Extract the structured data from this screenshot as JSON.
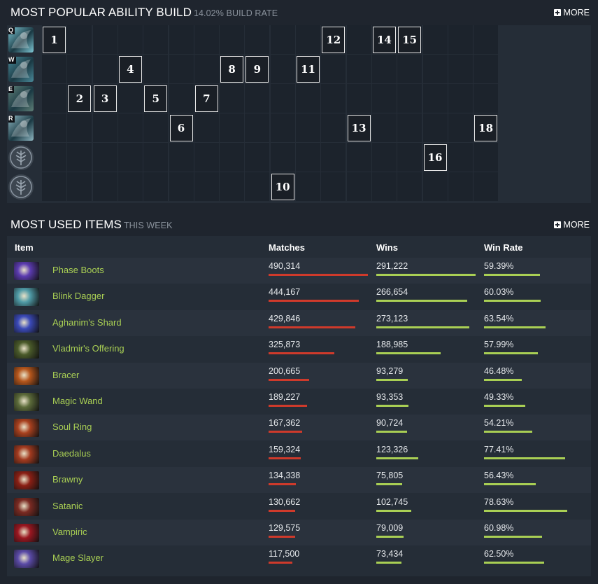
{
  "ability_build": {
    "title": "Most Popular Ability Build",
    "subtitle": "14.02% Build Rate",
    "more_label": "MORE",
    "abilities": [
      {
        "key": "Q",
        "icon": "ability-q-icon",
        "color": "#7fc9d6"
      },
      {
        "key": "W",
        "icon": "ability-w-icon",
        "color": "#4a8a9a"
      },
      {
        "key": "E",
        "icon": "ability-e-icon",
        "color": "#5f7f77"
      },
      {
        "key": "R",
        "icon": "ability-r-icon",
        "color": "#8fb7c2"
      },
      {
        "key": "",
        "icon": "talent-tree-icon",
        "color": "#3d4650"
      },
      {
        "key": "",
        "icon": "talent-tree-icon",
        "color": "#3d4650"
      }
    ],
    "levels": [
      {
        "level": "1",
        "row": 0,
        "col": 0
      },
      {
        "level": "2",
        "row": 2,
        "col": 1
      },
      {
        "level": "3",
        "row": 2,
        "col": 2
      },
      {
        "level": "4",
        "row": 1,
        "col": 3
      },
      {
        "level": "5",
        "row": 2,
        "col": 4
      },
      {
        "level": "6",
        "row": 3,
        "col": 5
      },
      {
        "level": "7",
        "row": 2,
        "col": 6
      },
      {
        "level": "8",
        "row": 1,
        "col": 7
      },
      {
        "level": "9",
        "row": 1,
        "col": 8
      },
      {
        "level": "10",
        "row": 5,
        "col": 9
      },
      {
        "level": "11",
        "row": 1,
        "col": 10
      },
      {
        "level": "12",
        "row": 0,
        "col": 11
      },
      {
        "level": "13",
        "row": 3,
        "col": 12
      },
      {
        "level": "14",
        "row": 0,
        "col": 13
      },
      {
        "level": "15",
        "row": 0,
        "col": 14
      },
      {
        "level": "16",
        "row": 4,
        "col": 15
      },
      {
        "level": "18",
        "row": 3,
        "col": 17
      }
    ]
  },
  "items": {
    "title": "Most Used Items",
    "subtitle": "This Week",
    "more_label": "MORE",
    "headers": {
      "item": "Item",
      "matches": "Matches",
      "wins": "Wins",
      "win_rate": "Win Rate"
    },
    "rows": [
      {
        "name": "Phase Boots",
        "matches": "490,314",
        "wins": "291,222",
        "win_rate": "59.39%",
        "m": 490314,
        "w": 291222,
        "wr": 59.39,
        "icon": "phase-boots-icon",
        "color": "#5b3bb0"
      },
      {
        "name": "Blink Dagger",
        "matches": "444,167",
        "wins": "266,654",
        "win_rate": "60.03%",
        "m": 444167,
        "w": 266654,
        "wr": 60.03,
        "icon": "blink-dagger-icon",
        "color": "#4f9aa6"
      },
      {
        "name": "Aghanim's Shard",
        "matches": "429,846",
        "wins": "273,123",
        "win_rate": "63.54%",
        "m": 429846,
        "w": 273123,
        "wr": 63.54,
        "icon": "aghanims-shard-icon",
        "color": "#3a49b8"
      },
      {
        "name": "Vladmir's Offering",
        "matches": "325,873",
        "wins": "188,985",
        "win_rate": "57.99%",
        "m": 325873,
        "w": 188985,
        "wr": 57.99,
        "icon": "vladmirs-offering-icon",
        "color": "#4a5a2a"
      },
      {
        "name": "Bracer",
        "matches": "200,665",
        "wins": "93,279",
        "win_rate": "46.48%",
        "m": 200665,
        "w": 93279,
        "wr": 46.48,
        "icon": "bracer-icon",
        "color": "#b5561c"
      },
      {
        "name": "Magic Wand",
        "matches": "189,227",
        "wins": "93,353",
        "win_rate": "49.33%",
        "m": 189227,
        "w": 93353,
        "wr": 49.33,
        "icon": "magic-wand-icon",
        "color": "#5c6b3a"
      },
      {
        "name": "Soul Ring",
        "matches": "167,362",
        "wins": "90,724",
        "win_rate": "54.21%",
        "m": 167362,
        "w": 90724,
        "wr": 54.21,
        "icon": "soul-ring-icon",
        "color": "#a8401e"
      },
      {
        "name": "Daedalus",
        "matches": "159,324",
        "wins": "123,326",
        "win_rate": "77.41%",
        "m": 159324,
        "w": 123326,
        "wr": 77.41,
        "icon": "daedalus-icon",
        "color": "#a23a1f"
      },
      {
        "name": "Brawny",
        "matches": "134,338",
        "wins": "75,805",
        "win_rate": "56.43%",
        "m": 134338,
        "w": 75805,
        "wr": 56.43,
        "icon": "brawny-icon",
        "color": "#8a1f14"
      },
      {
        "name": "Satanic",
        "matches": "130,662",
        "wins": "102,745",
        "win_rate": "78.63%",
        "m": 130662,
        "w": 102745,
        "wr": 78.63,
        "icon": "satanic-icon",
        "color": "#7a2a22"
      },
      {
        "name": "Vampiric",
        "matches": "129,575",
        "wins": "79,009",
        "win_rate": "60.98%",
        "m": 129575,
        "w": 79009,
        "wr": 60.98,
        "icon": "vampiric-icon",
        "color": "#9a1620"
      },
      {
        "name": "Mage Slayer",
        "matches": "117,500",
        "wins": "73,434",
        "win_rate": "62.50%",
        "m": 117500,
        "w": 73434,
        "wr": 62.5,
        "icon": "mage-slayer-icon",
        "color": "#5a4aa6"
      }
    ]
  },
  "colors": {
    "matches_bar": "#cf3a2b",
    "wins_bar": "#a9cf54",
    "item_name": "#a9cf54"
  }
}
